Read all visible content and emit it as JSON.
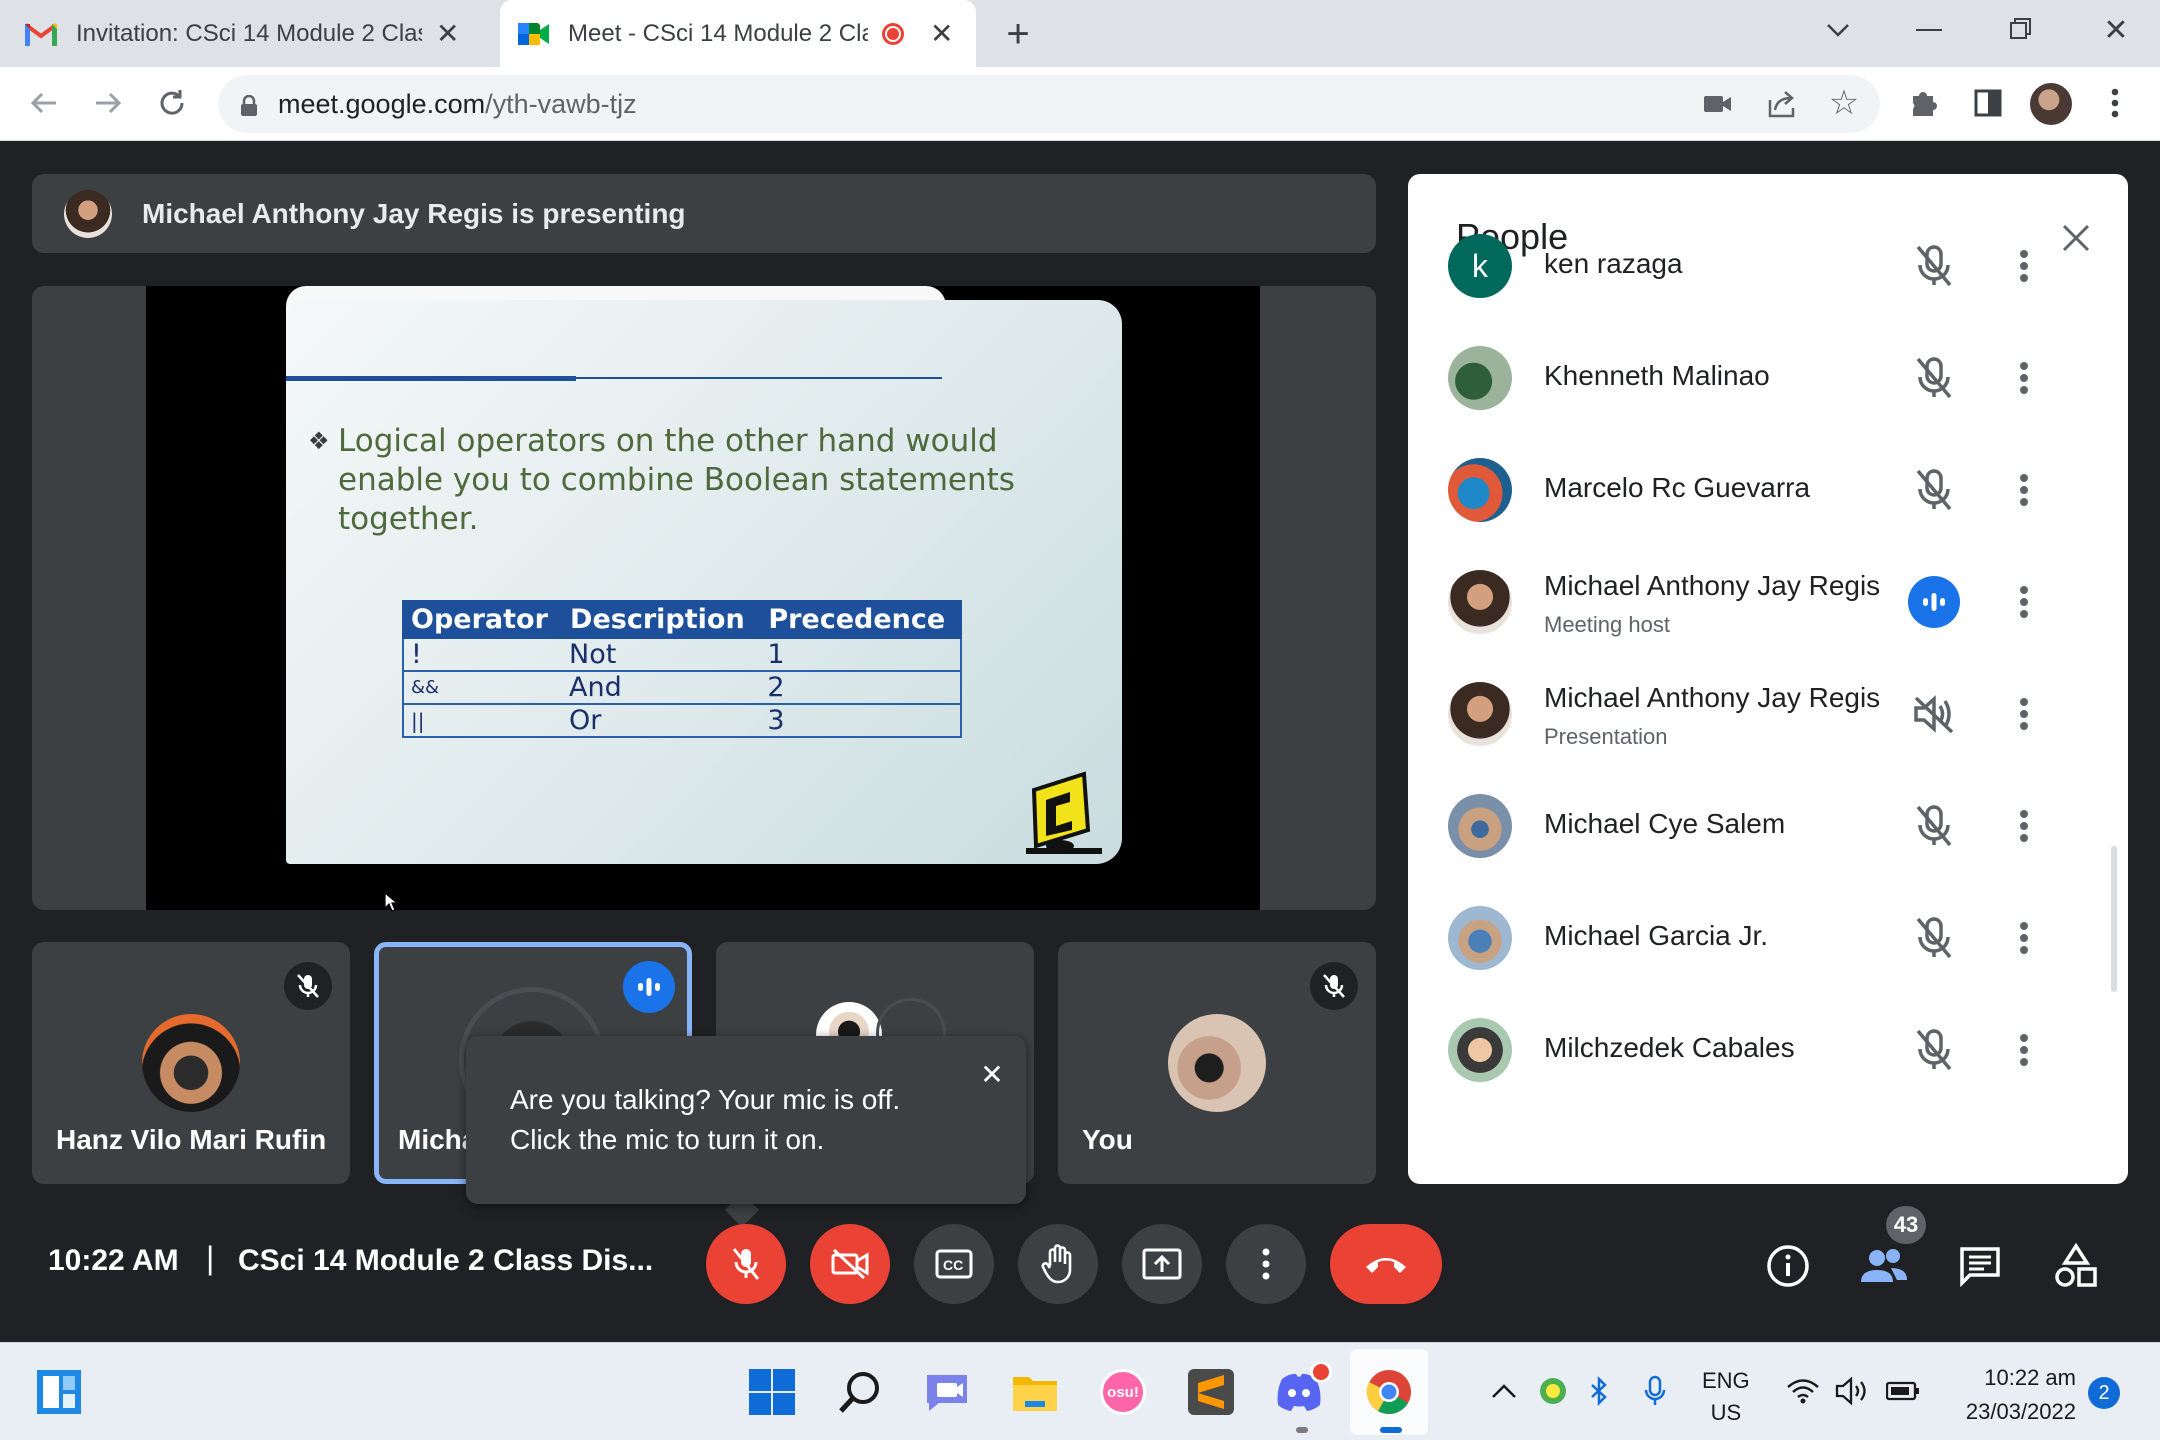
{
  "browser": {
    "tabs": [
      {
        "label": "Invitation: CSci 14 Module 2 Class Discussion",
        "icon": "gmail-icon"
      },
      {
        "label": "Meet - CSci 14 Module 2 Class Discussion",
        "icon": "meet-icon",
        "recording": true
      }
    ],
    "url_domain": "meet.google.com",
    "url_path": "/yth-vawb-tjz"
  },
  "meet": {
    "presenting_banner": "Michael Anthony Jay Regis is presenting",
    "slide": {
      "bullet": "❖",
      "text": "Logical operators on the other hand would enable you to combine Boolean statements together.",
      "table": {
        "headers": [
          "Operator",
          "Description",
          "Precedence"
        ],
        "rows": [
          [
            "!",
            "Not",
            "1"
          ],
          [
            "&&",
            "And",
            "2"
          ],
          [
            "||",
            "Or",
            "3"
          ]
        ]
      }
    },
    "tiles": [
      {
        "name": "Hanz Vilo Mari Rufin",
        "muted": true
      },
      {
        "name": "Micha",
        "speaking": true
      },
      {
        "name": ""
      },
      {
        "name": "You",
        "muted": true
      }
    ],
    "tooltip": {
      "line1": "Are you talking? Your mic is off.",
      "line2": "Click the mic to turn it on."
    },
    "bottom": {
      "time": "10:22 AM",
      "separator": "|",
      "meeting_title": "CSci 14 Module 2 Class Dis...",
      "participant_count": "43"
    }
  },
  "people_panel": {
    "title": "People",
    "participants": [
      {
        "name": "ken razaga",
        "subtitle": "",
        "initial": "k",
        "status": "muted"
      },
      {
        "name": "Khenneth Malinao",
        "subtitle": "",
        "status": "muted"
      },
      {
        "name": "Marcelo Rc Guevarra",
        "subtitle": "",
        "status": "muted"
      },
      {
        "name": "Michael Anthony Jay Regis",
        "subtitle": "Meeting host",
        "status": "speaking"
      },
      {
        "name": "Michael Anthony Jay Regis",
        "subtitle": "Presentation",
        "status": "audio-muted"
      },
      {
        "name": "Michael Cye Salem",
        "subtitle": "",
        "status": "muted"
      },
      {
        "name": "Michael Garcia Jr.",
        "subtitle": "",
        "status": "muted"
      },
      {
        "name": "Milchzedek Cabales",
        "subtitle": "",
        "status": "muted"
      }
    ]
  },
  "taskbar": {
    "lang_line1": "ENG",
    "lang_line2": "US",
    "clock_time": "10:22 am",
    "clock_date": "23/03/2022",
    "notification_count": "2",
    "osu_label": "osu!"
  },
  "colors": {
    "meet_bg": "#202124",
    "tile_bg": "#3c4043",
    "accent_blue": "#1a73e8",
    "danger_red": "#ea4335"
  }
}
